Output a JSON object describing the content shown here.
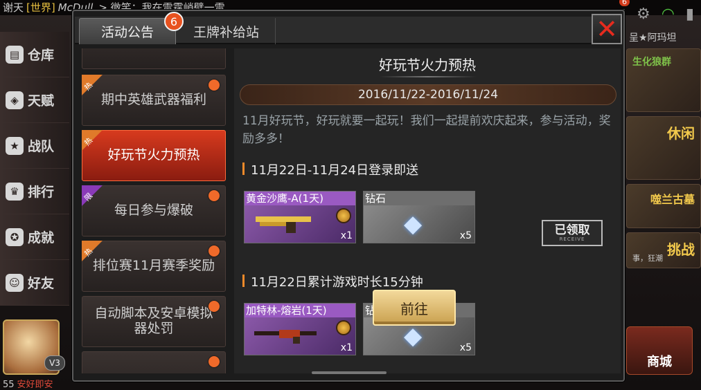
{
  "background": {
    "chat_prefix": "谢天",
    "chat_channel": "[世界]",
    "chat_sender": "McDull",
    "chat_message": "> 微笑：我在雷霆峭壁一雷",
    "notification_count": "6",
    "left_menu": [
      {
        "label": "仓库",
        "icon": "warehouse-icon"
      },
      {
        "label": "天赋",
        "icon": "talent-icon"
      },
      {
        "label": "战队",
        "icon": "team-icon"
      },
      {
        "label": "排行",
        "icon": "trophy-icon"
      },
      {
        "label": "成就",
        "icon": "achievement-icon"
      },
      {
        "label": "好友",
        "icon": "friends-icon"
      }
    ],
    "vip_badge": "V3",
    "level_text": "55",
    "player_name": "安好即安",
    "right_name": "呈★阿玛坦",
    "right_cards": [
      {
        "label": "生化狼群"
      },
      {
        "label": "休闲"
      },
      {
        "label": "噬兰古墓"
      },
      {
        "label": "挑战"
      }
    ],
    "right_small_text": "事，狂潮",
    "shop_label": "商城"
  },
  "modal": {
    "tabs": [
      {
        "label": "活动公告",
        "badge": "6"
      },
      {
        "label": "王牌补给站"
      }
    ],
    "list_items": [
      {
        "label": "",
        "ribbon": "",
        "ribbon_color": "orange",
        "active": false,
        "dot": false
      },
      {
        "label": "期中英雄武器福利",
        "ribbon": "热",
        "ribbon_color": "orange",
        "active": false,
        "dot": true
      },
      {
        "label": "好玩节火力预热",
        "ribbon": "热",
        "ribbon_color": "orange",
        "active": true,
        "dot": false
      },
      {
        "label": "每日参与爆破",
        "ribbon": "限",
        "ribbon_color": "purple",
        "active": false,
        "dot": true
      },
      {
        "label": "排位赛11月赛季奖励",
        "ribbon": "热",
        "ribbon_color": "orange",
        "active": false,
        "dot": true
      },
      {
        "label": "自动脚本及安卓模拟器处罚",
        "ribbon": "",
        "ribbon_color": "",
        "active": false,
        "dot": true
      },
      {
        "label": "",
        "ribbon": "",
        "ribbon_color": "",
        "active": false,
        "dot": true
      }
    ],
    "content": {
      "title": "好玩节火力预热",
      "date_range": "2016/11/22-2016/11/24",
      "description": "11月好玩节，好玩就要一起玩！我们一起提前欢庆起来，参与活动，奖励多多！",
      "sections": [
        {
          "heading": "11月22日-11月24日登录即送",
          "rewards": [
            {
              "caption": "黄金沙鹰-A(1天)",
              "type": "weapon",
              "qty": "x1",
              "icon": "golden-pistol-icon"
            },
            {
              "caption": "钻石",
              "type": "gem",
              "qty": "x5",
              "icon": "diamond-icon"
            }
          ],
          "action": {
            "type": "claimed",
            "label": "已领取",
            "sub": "RECEIVE"
          }
        },
        {
          "heading": "11月22日累计游戏时长15分钟",
          "rewards": [
            {
              "caption": "加特林-熔岩(1天)",
              "type": "weapon",
              "qty": "x1",
              "icon": "gatling-gun-icon"
            },
            {
              "caption": "钻石",
              "type": "gem",
              "qty": "x5",
              "icon": "diamond-icon"
            }
          ],
          "action": {
            "type": "goto",
            "label": "前往"
          }
        }
      ]
    }
  },
  "colors": {
    "accent_red": "#d73a1e",
    "badge_orange": "#e8521f",
    "gold_button": "#c9a04e",
    "weapon_purple": "#9a5ac2"
  }
}
